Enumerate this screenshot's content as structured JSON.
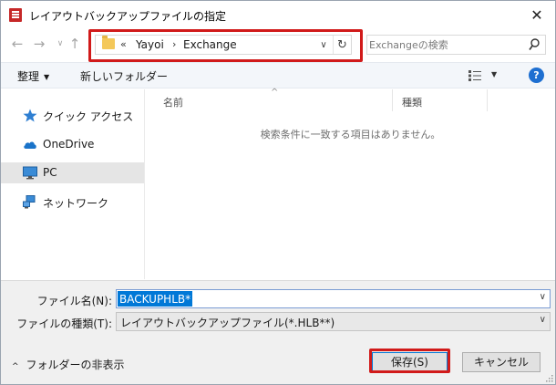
{
  "window": {
    "title": "レイアウトバックアップファイルの指定",
    "close_glyph": "✕"
  },
  "nav_buttons": {
    "back": "←",
    "forward": "→",
    "recent": "∨",
    "up": "↑"
  },
  "address": {
    "overflow": "«",
    "crumbs": [
      "Yayoi",
      "Exchange"
    ],
    "separator": "›",
    "dropdown_glyph": "∨",
    "refresh_glyph": "↻"
  },
  "search": {
    "placeholder": "Exchangeの検索"
  },
  "toolbar": {
    "organize": "整理",
    "caret": "▼",
    "new_folder": "新しいフォルダー",
    "help": "?"
  },
  "sidebar": {
    "items": [
      {
        "label": "クイック アクセス",
        "icon": "star-icon"
      },
      {
        "label": "OneDrive",
        "icon": "cloud-icon"
      },
      {
        "label": "PC",
        "icon": "monitor-icon",
        "selected": true
      },
      {
        "label": "ネットワーク",
        "icon": "network-icon"
      }
    ]
  },
  "file_list": {
    "columns": [
      "名前",
      "種類"
    ],
    "sort_glyph": "^",
    "empty_message": "検索条件に一致する項目はありません。"
  },
  "form": {
    "filename_label": "ファイル名(N):",
    "filename_value": "BACKUPHLB**",
    "filetype_label": "ファイルの種類(T):",
    "filetype_value": "レイアウトバックアップファイル(*.HLB**)",
    "dropdown_glyph": "∨"
  },
  "footer": {
    "hide_folders": "フォルダーの非表示",
    "hide_caret": "^",
    "save_label": "保存(S)",
    "cancel_label": "キャンセル"
  },
  "colors": {
    "highlight_red": "#d11a1a",
    "accent_blue": "#0078d7",
    "help_blue": "#1e6fd1"
  }
}
